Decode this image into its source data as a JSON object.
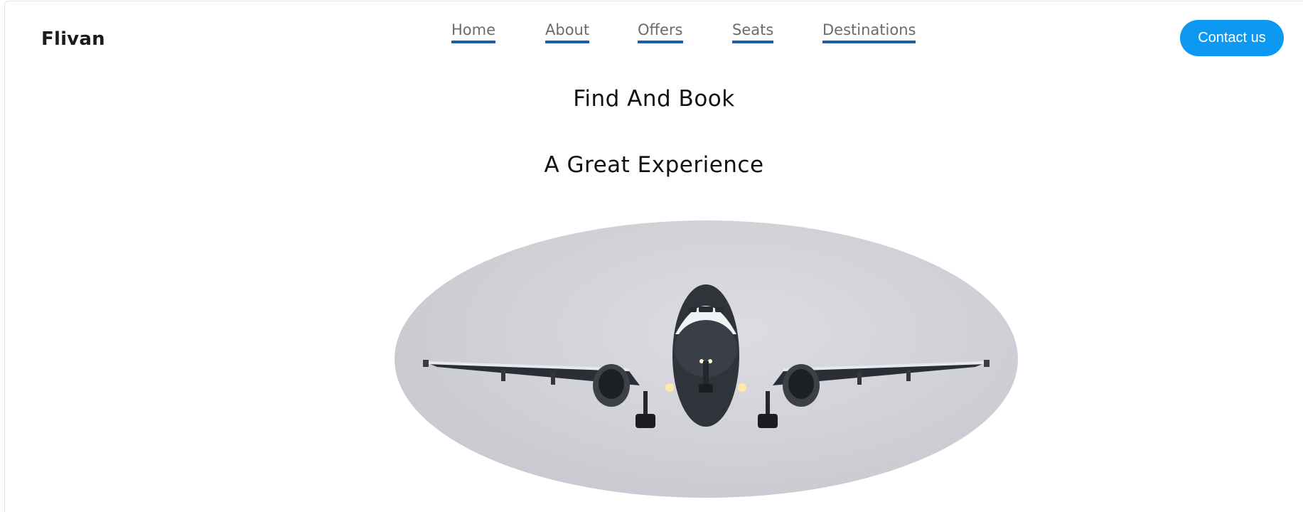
{
  "header": {
    "brand": "Flivan",
    "nav": [
      {
        "label": "Home"
      },
      {
        "label": "About"
      },
      {
        "label": "Offers"
      },
      {
        "label": "Seats"
      },
      {
        "label": "Destinations"
      }
    ],
    "contact_label": "Contact us"
  },
  "hero": {
    "headline_1": "Find And Book",
    "headline_2": "A Great Experience",
    "image_subject": "airplane-front-view"
  },
  "colors": {
    "nav_underline": "#1a5fa8",
    "button": "#0d99f2"
  }
}
